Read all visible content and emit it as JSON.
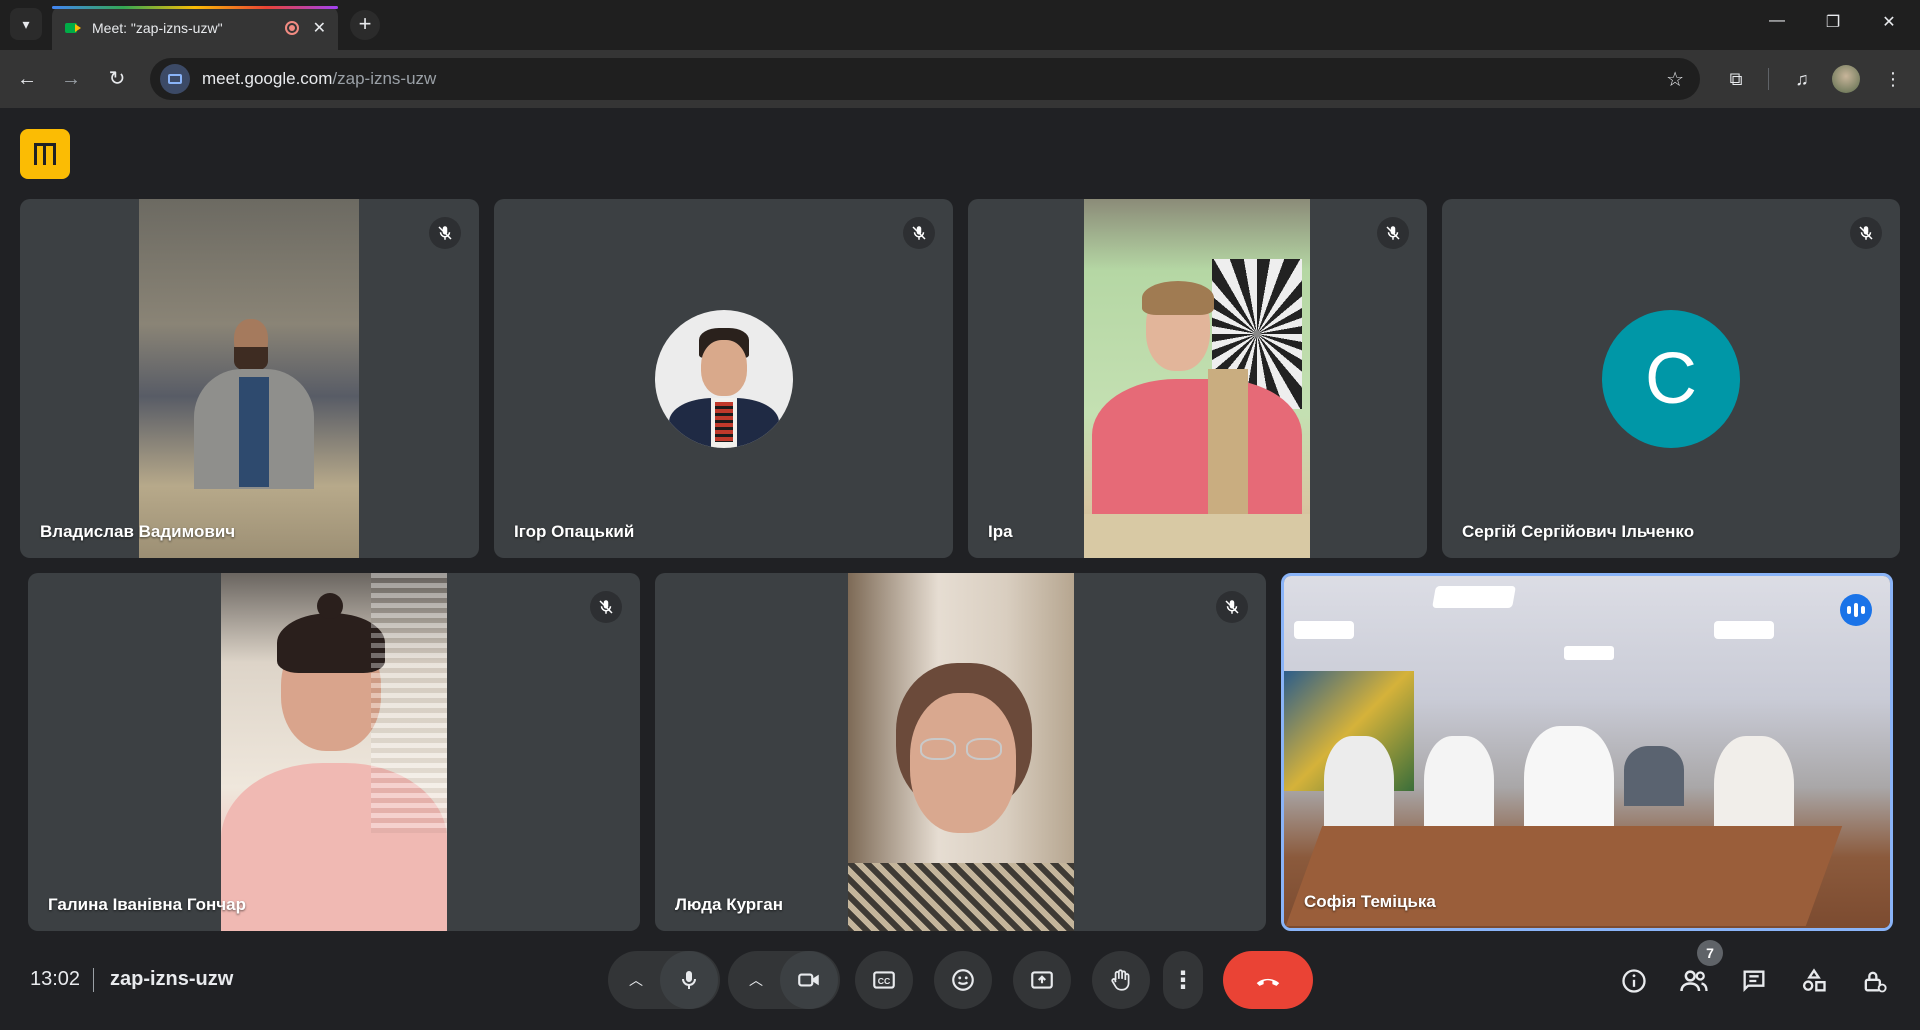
{
  "browser": {
    "tab_title": "Meet: \"zap-izns-uzw\"",
    "url_host": "meet.google.com",
    "url_path": "/zap-izns-uzw",
    "new_tab_label": "+",
    "tab_close_label": "✕"
  },
  "meeting": {
    "time": "13:02",
    "code": "zap-izns-uzw",
    "participant_count": "7"
  },
  "participants": [
    {
      "name": "Владислав Вадимович",
      "muted": true,
      "video": true
    },
    {
      "name": "Ігор Опацький",
      "muted": true,
      "video": false,
      "avatar": "photo"
    },
    {
      "name": "Іра",
      "muted": true,
      "video": true
    },
    {
      "name": "Сергій Сергійович Ільченко",
      "muted": true,
      "video": false,
      "avatar_letter": "C",
      "avatar_color": "#0097a7"
    },
    {
      "name": "Галина Іванівна Гончар",
      "muted": true,
      "video": true
    },
    {
      "name": "Люда Курган",
      "muted": true,
      "video": true
    },
    {
      "name": "Софія Теміцька",
      "muted": false,
      "speaking": true,
      "video": true
    }
  ],
  "colors": {
    "background": "#202124",
    "tile": "#3c4043",
    "leave": "#ea4335",
    "active_border": "#8ab4f8",
    "activity_button": "#fbbc04"
  },
  "controls": [
    "chevron-up-icon",
    "mic-icon",
    "chevron-up-icon",
    "camera-icon",
    "captions-icon",
    "emoji-icon",
    "present-icon",
    "hand-icon",
    "more-vert-icon",
    "call-end-icon"
  ],
  "side_controls": [
    "info-icon",
    "people-icon",
    "chat-icon",
    "activities-icon",
    "host-controls-icon"
  ]
}
